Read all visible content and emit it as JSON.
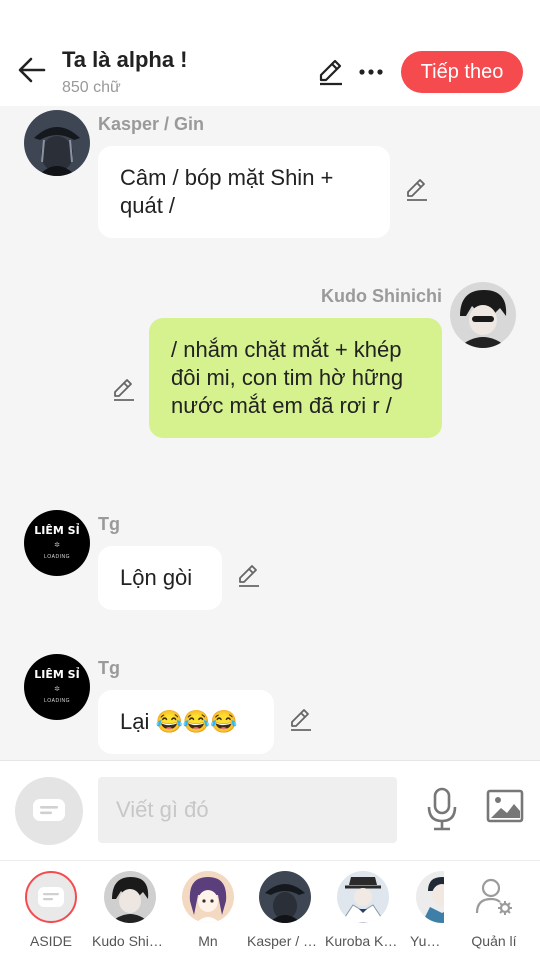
{
  "header": {
    "title": "Ta là alpha !",
    "word_count": "850 chữ",
    "next_button": "Tiếp theo"
  },
  "messages": [
    {
      "sender": "Kasper / Gin",
      "text": "Câm / bóp mặt Shin + quát /",
      "side": "left",
      "avatar": "dark-hat-character-avatar"
    },
    {
      "sender": "Kudo Shinichi",
      "text": "/ nhắm chặt mắt + khép đôi mi, con tim hờ hững nước mắt em đã rơi r /",
      "side": "right",
      "avatar": "dark-haired-boy-avatar"
    },
    {
      "sender": "Tg",
      "text": "Lộn gòi",
      "side": "left",
      "avatar_text": "LIÊM SỈ",
      "avatar_sub": "LOADING"
    },
    {
      "sender": "Tg",
      "text": "Lại 😂😂😂",
      "side": "left",
      "avatar_text": "LIÊM SỈ",
      "avatar_sub": "LOADING"
    }
  ],
  "input": {
    "placeholder": "Viết gì đó"
  },
  "characters": [
    {
      "label": "ASIDE"
    },
    {
      "label": "Kudo Shinichi"
    },
    {
      "label": "Mn"
    },
    {
      "label": "Kasper / Gin"
    },
    {
      "label": "Kuroba Kaito"
    },
    {
      "label": "Yusaku"
    },
    {
      "label": "Quản lí"
    }
  ],
  "colors": {
    "accent": "#f54b4f",
    "right_bubble": "#d6f28f",
    "left_bubble": "#ffffff",
    "background": "#f5f5f5"
  }
}
